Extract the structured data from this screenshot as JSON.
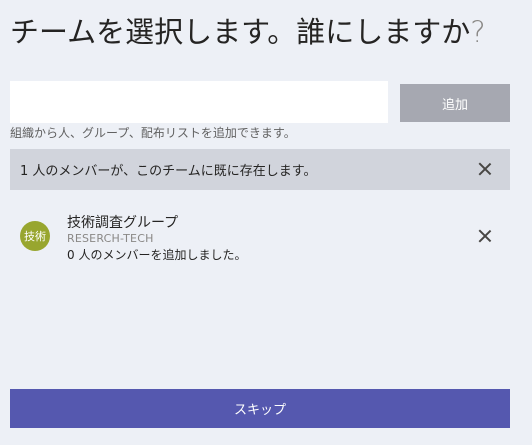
{
  "dialog": {
    "title_main": "チームを選択します。誰にしますか",
    "title_mark": "?"
  },
  "search": {
    "value": "",
    "placeholder": ""
  },
  "add_button": {
    "label": "追加"
  },
  "hint": "組織から人、グループ、配布リストを追加できます。",
  "notice": {
    "text": "1 人のメンバーが、このチームに既に存在します。"
  },
  "group": {
    "avatar_text": "技術",
    "avatar_color": "#98a62f",
    "name": "技術調査グループ",
    "alias": "RESERCH-TECH",
    "status": "0 人のメンバーを追加しました。"
  },
  "skip_button": {
    "label": "スキップ"
  },
  "colors": {
    "accent": "#5558af",
    "disabled_button": "#a6a8b1",
    "background": "#edf0f6",
    "notice_background": "#d1d4dc"
  }
}
